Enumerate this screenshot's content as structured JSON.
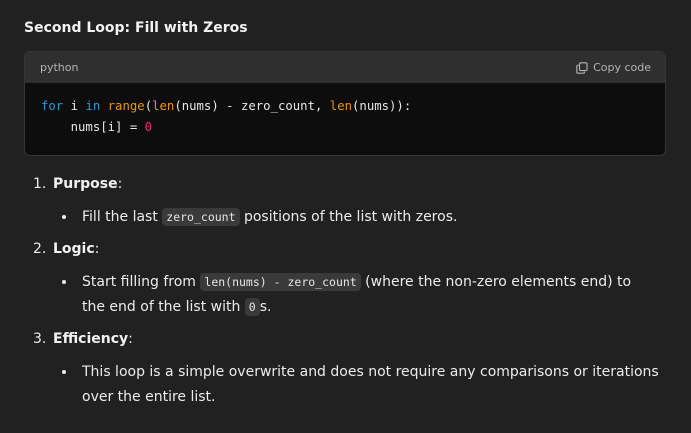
{
  "heading": "Second Loop: Fill with Zeros",
  "code_block": {
    "language": "python",
    "copy_label": "Copy code",
    "line1": {
      "for": "for",
      "i": " i ",
      "in": "in",
      "sp1": " ",
      "range": "range",
      "p1": "(",
      "len1": "len",
      "mid": "(nums) - zero_count, ",
      "len2": "len",
      "end": "(nums)):"
    },
    "line2": {
      "left": "    nums[i] = ",
      "zero": "0"
    }
  },
  "items": [
    {
      "number": "1.",
      "title": "Purpose",
      "colon": ":",
      "bullet": {
        "pre": "Fill the last ",
        "code": "zero_count",
        "post": " positions of the list with zeros."
      }
    },
    {
      "number": "2.",
      "title": "Logic",
      "colon": ":",
      "bullet": {
        "pre": "Start filling from ",
        "code": "len(nums) - zero_count",
        "mid": " (where the non-zero elements end) to the end of the list with ",
        "code2": "0",
        "post": "s."
      }
    },
    {
      "number": "3.",
      "title": "Efficiency",
      "colon": ":",
      "bullet": {
        "text": "This loop is a simple overwrite and does not require any comparisons or iterations over the entire list."
      }
    }
  ],
  "colors": {
    "background": "#212121",
    "code_background": "#0d0d0d",
    "code_header": "#2f2f2f",
    "keyword": "#2e95d3",
    "builtin": "#e9950c",
    "number": "#df3079"
  },
  "icons": {
    "copy": "copy-icon"
  }
}
